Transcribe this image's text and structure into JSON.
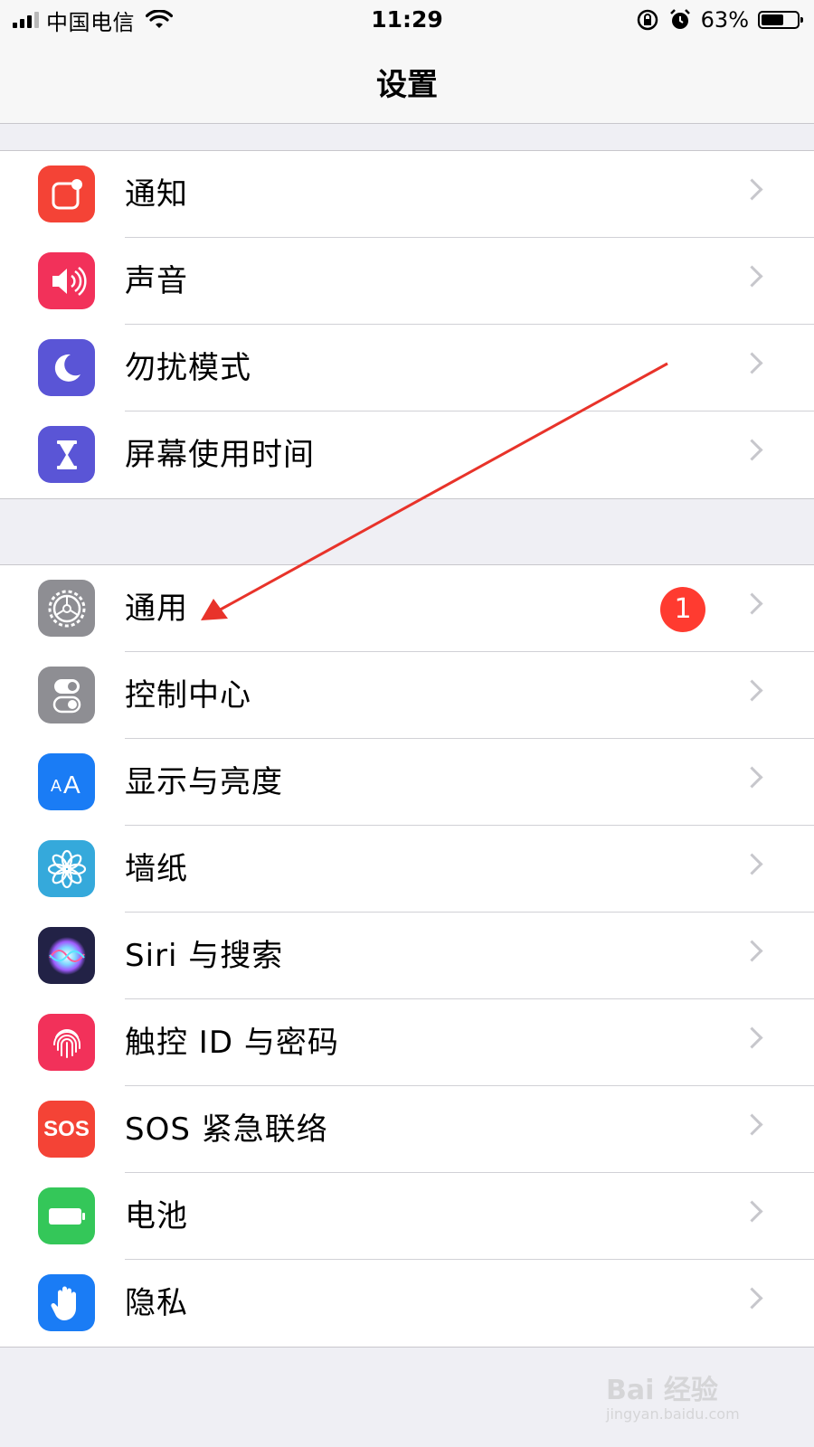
{
  "status_bar": {
    "carrier": "中国电信",
    "time": "11:29",
    "battery_percent": "63%",
    "battery_level": 0.63
  },
  "nav": {
    "title": "设置"
  },
  "groups": [
    {
      "rows": [
        {
          "label": "通知",
          "icon": "notifications-icon",
          "icon_color": "#f44336"
        },
        {
          "label": "声音",
          "icon": "speaker-icon",
          "icon_color": "#f2315a"
        },
        {
          "label": "勿扰模式",
          "icon": "moon-icon",
          "icon_color": "#5a55d6"
        },
        {
          "label": "屏幕使用时间",
          "icon": "hourglass-icon",
          "icon_color": "#5a55d6"
        }
      ]
    },
    {
      "rows": [
        {
          "label": "通用",
          "icon": "gear-icon",
          "icon_color": "#8e8e93",
          "badge": "1"
        },
        {
          "label": "控制中心",
          "icon": "toggles-icon",
          "icon_color": "#8e8e93"
        },
        {
          "label": "显示与亮度",
          "icon": "text-size-icon",
          "icon_color": "#1a7cf5"
        },
        {
          "label": "墙纸",
          "icon": "flower-icon",
          "icon_color": "#35a9db"
        },
        {
          "label": "Siri 与搜索",
          "icon": "siri-icon",
          "icon_color": "#222246"
        },
        {
          "label": "触控 ID 与密码",
          "icon": "fingerprint-icon",
          "icon_color": "#f2315a"
        },
        {
          "label": "SOS 紧急联络",
          "icon": "sos-icon",
          "icon_color": "#f44336",
          "icon_text": "SOS"
        },
        {
          "label": "电池",
          "icon": "battery-icon",
          "icon_color": "#34c759"
        },
        {
          "label": "隐私",
          "icon": "hand-icon",
          "icon_color": "#1a7cf5"
        }
      ]
    }
  ],
  "annotation": {
    "color": "#e8332a"
  },
  "watermark": {
    "text": "Bai 经验",
    "sub": "jingyan.baidu.com"
  }
}
